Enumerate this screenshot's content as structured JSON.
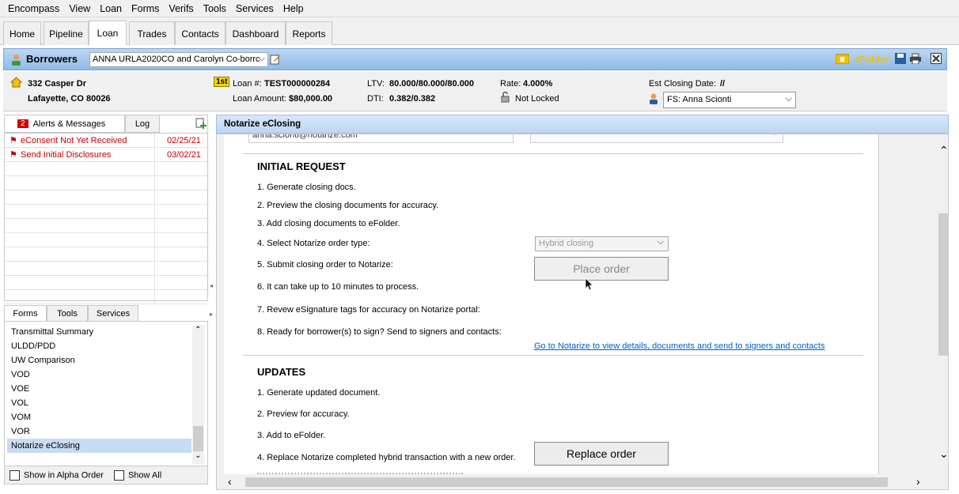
{
  "menu": [
    "Encompass",
    "View",
    "Loan",
    "Forms",
    "Verifs",
    "Tools",
    "Services",
    "Help"
  ],
  "tabs": [
    "Home",
    "Pipeline",
    "Loan",
    "Trades",
    "Contacts",
    "Dashboard",
    "Reports"
  ],
  "borrowers": {
    "title": "Borrowers",
    "selected": "ANNA URLA2020CO and Carolyn Co-borrc",
    "efolder": "eFolder"
  },
  "loan_info": {
    "address_line1": "332 Casper Dr",
    "address_line2": "Lafayette, CO 80026",
    "lien_badge": "1st",
    "loan_num_label": "Loan #:",
    "loan_num": "TEST000000284",
    "loan_amount_label": "Loan Amount:",
    "loan_amount": "$80,000.00",
    "ltv_label": "LTV:",
    "ltv": "80.000/80.000/80.000",
    "dti_label": "DTI:",
    "dti": "0.382/0.382",
    "rate_label": "Rate:",
    "rate": "4.000%",
    "lock_status": "Not Locked",
    "closing_label": "Est Closing Date:",
    "closing_date": "//",
    "fs_selected": "FS: Anna Scionti"
  },
  "alerts": {
    "count": "2",
    "tab_alerts": "Alerts & Messages",
    "tab_log": "Log",
    "rows": [
      {
        "text": "eConsent Not Yet Received",
        "date": "02/25/21"
      },
      {
        "text": "Send Initial Disclosures",
        "date": "03/02/21"
      }
    ]
  },
  "forms_panel": {
    "tabs": [
      "Forms",
      "Tools",
      "Services"
    ],
    "items": [
      "Transmittal Summary",
      "ULDD/PDD",
      "UW Comparison",
      "VOD",
      "VOE",
      "VOL",
      "VOM",
      "VOR",
      "Notarize eClosing"
    ],
    "selected_index": 8,
    "show_alpha": "Show in Alpha Order",
    "show_all": "Show All"
  },
  "main": {
    "header": "Notarize eClosing",
    "email_partial": "anna.scionti@notarize.com",
    "initial_request": {
      "title": "INITIAL REQUEST",
      "steps": [
        "1. Generate closing docs.",
        "2. Preview the closing documents for accuracy.",
        "3. Add closing documents to eFolder.",
        "4. Select Notarize order type:",
        "5. Submit closing order to Notarize:",
        "6. It can take up to 10 minutes to process.",
        "7. Revew eSignature tags for accuracy on Notarize portal:",
        "8. Ready for borrower(s) to sign? Send to signers and contacts:"
      ],
      "order_type": "Hybrid closing",
      "place_order": "Place order",
      "notarize_link": "Go to Notarize to view details, documents and send to signers and contacts"
    },
    "updates": {
      "title": "UPDATES",
      "steps": [
        "1. Generate updated document.",
        "2. Preview for accuracy.",
        "3. Add to eFolder.",
        "4. Replace Notarize completed hybrid transaction with a new order."
      ],
      "replace_order": "Replace order"
    }
  }
}
